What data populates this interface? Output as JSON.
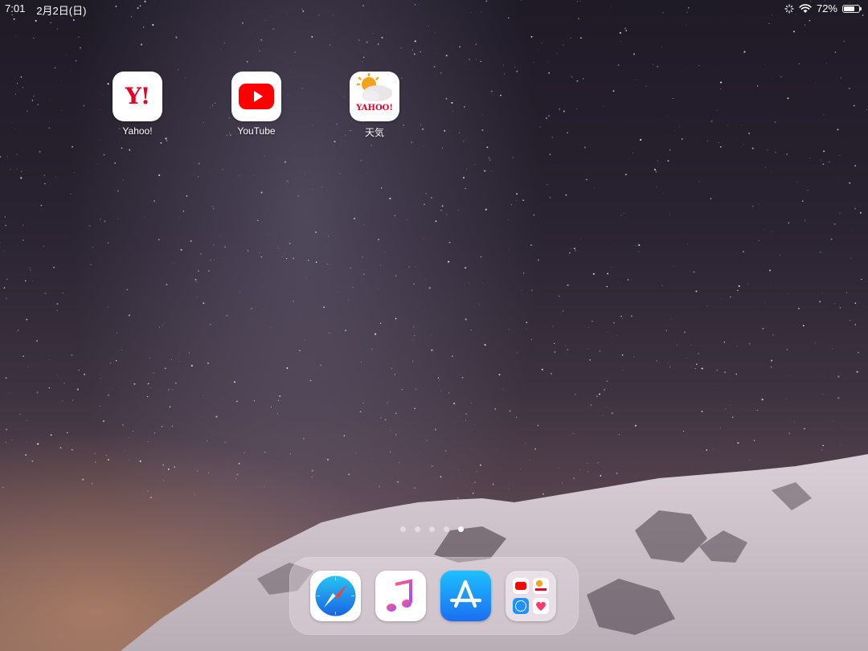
{
  "status_bar": {
    "time": "7:01",
    "date": "2月2日(日)",
    "battery_percent": "72%",
    "battery_level": 0.72,
    "icons": [
      "do-not-disturb-icon",
      "wifi-icon",
      "battery-icon"
    ]
  },
  "home_apps": [
    {
      "label": "Yahoo!",
      "icon": "yahoo-icon",
      "logo_text": "Y!"
    },
    {
      "label": "YouTube",
      "icon": "youtube-icon"
    },
    {
      "label": "天気",
      "icon": "yahoo-weather-icon",
      "logo_text": "YAHOO!"
    }
  ],
  "page_indicator": {
    "count": 5,
    "active_index": 4
  },
  "dock": {
    "apps": [
      {
        "icon": "safari-icon"
      },
      {
        "icon": "music-icon"
      },
      {
        "icon": "app-store-icon"
      },
      {
        "icon": "folder-icon",
        "contents": [
          "youtube-icon",
          "yahoo-weather-icon",
          "safari-icon",
          "health-icon"
        ]
      }
    ]
  },
  "colors": {
    "yahoo_red": "#e60026",
    "youtube_red": "#ff0000",
    "appstore_blue": "#1a8cf5",
    "safari_blue": "#1e90ff"
  }
}
